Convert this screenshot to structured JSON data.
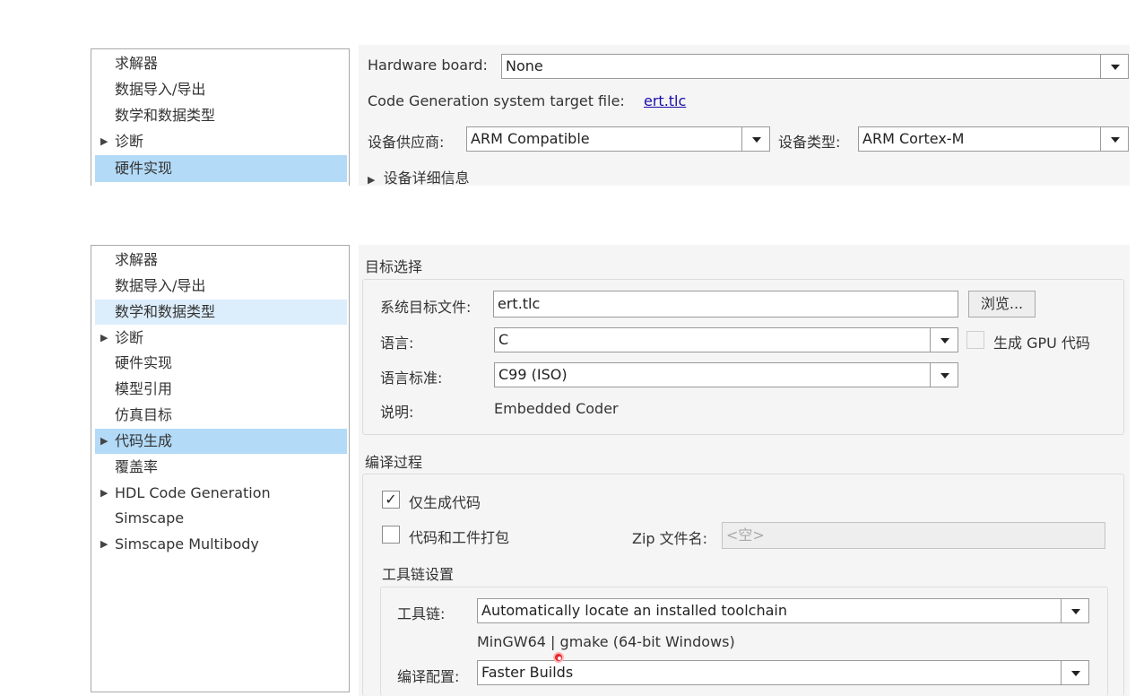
{
  "top": {
    "tree_items": [
      {
        "label": "求解器",
        "arrow": ""
      },
      {
        "label": "数据导入/导出",
        "arrow": ""
      },
      {
        "label": "数学和数据类型",
        "arrow": ""
      },
      {
        "label": "诊断",
        "arrow": "▶"
      },
      {
        "label": "硬件实现",
        "arrow": ""
      }
    ],
    "hardware_board_label": "Hardware board:",
    "hardware_board_value": "None",
    "codegen_target_label": "Code Generation system target file:",
    "codegen_target_link": "ert.tlc",
    "device_vendor_label": "设备供应商:",
    "device_vendor_value": "ARM Compatible",
    "device_type_label": "设备类型:",
    "device_type_value": "ARM Cortex-M",
    "device_details_arrow": "▶",
    "device_details_label": "设备详细信息"
  },
  "bottom": {
    "tree_items": [
      {
        "label": "求解器",
        "arrow": ""
      },
      {
        "label": "数据导入/导出",
        "arrow": ""
      },
      {
        "label": "数学和数据类型",
        "arrow": ""
      },
      {
        "label": "诊断",
        "arrow": "▶"
      },
      {
        "label": "硬件实现",
        "arrow": ""
      },
      {
        "label": "模型引用",
        "arrow": ""
      },
      {
        "label": "仿真目标",
        "arrow": ""
      },
      {
        "label": "代码生成",
        "arrow": "▶"
      },
      {
        "label": "覆盖率",
        "arrow": ""
      },
      {
        "label": "HDL Code Generation",
        "arrow": "▶"
      },
      {
        "label": "Simscape",
        "arrow": ""
      },
      {
        "label": "Simscape Multibody",
        "arrow": "▶"
      }
    ],
    "target_section_title": "目标选择",
    "system_target_label": "系统目标文件:",
    "system_target_value": "ert.tlc",
    "browse_button": "浏览...",
    "language_label": "语言:",
    "language_value": "C",
    "gpu_code_label": "生成 GPU 代码",
    "language_standard_label": "语言标准:",
    "language_standard_value": "C99 (ISO)",
    "description_label": "说明:",
    "description_value": "Embedded Coder",
    "build_section_title": "编译过程",
    "generate_code_only_label": "仅生成代码",
    "generate_code_only_check": "✓",
    "package_artifacts_label": "代码和工件打包",
    "zip_label": "Zip 文件名:",
    "zip_placeholder": "<空>",
    "toolchain_section_title": "工具链设置",
    "toolchain_label": "工具链:",
    "toolchain_value": "Automatically locate an installed toolchain",
    "toolchain_detected": "MinGW64 | gmake (64-bit Windows)",
    "build_config_label": "编译配置:",
    "build_config_value": "Faster Builds"
  }
}
